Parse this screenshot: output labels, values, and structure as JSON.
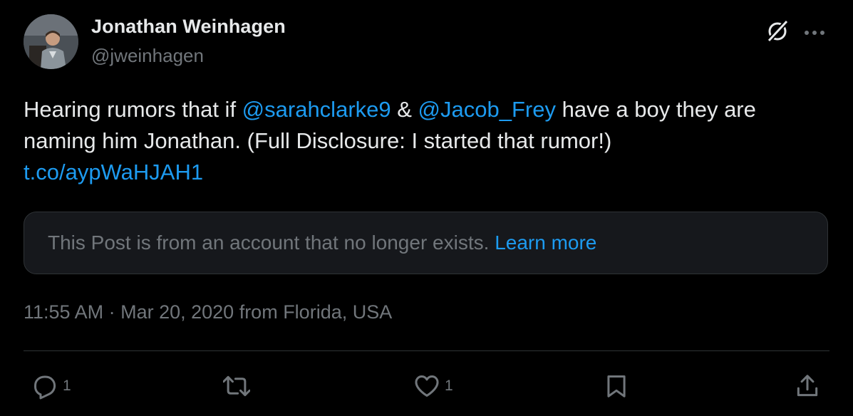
{
  "author": {
    "display_name": "Jonathan Weinhagen",
    "handle": "@jweinhagen"
  },
  "tweet": {
    "text_1": "Hearing rumors that if ",
    "mention_1": "@sarahclarke9",
    "text_2": " & ",
    "mention_2": "@Jacob_Frey",
    "text_3": " have a boy they are naming him Jonathan. (Full Disclosure: I started that rumor!)",
    "link": "t.co/aypWaHJAH1"
  },
  "notice": {
    "text": "This Post is from an account that no longer exists.",
    "link": "Learn more"
  },
  "meta": {
    "time": "11:55 AM",
    "separator": " · ",
    "date": "Mar 20, 2020",
    "location": " from Florida, USA"
  },
  "actions": {
    "reply_count": "1",
    "like_count": "1"
  },
  "icons": {
    "top_right": [
      "grok-icon",
      "more-icon"
    ],
    "actions": [
      "reply-icon",
      "repost-icon",
      "like-icon",
      "bookmark-icon",
      "share-icon"
    ]
  },
  "colors": {
    "background": "#000000",
    "text_primary": "#e7e9ea",
    "text_secondary": "#71767b",
    "accent": "#1d9bf0",
    "notice_background": "#16181c",
    "divider": "#2f3336"
  }
}
